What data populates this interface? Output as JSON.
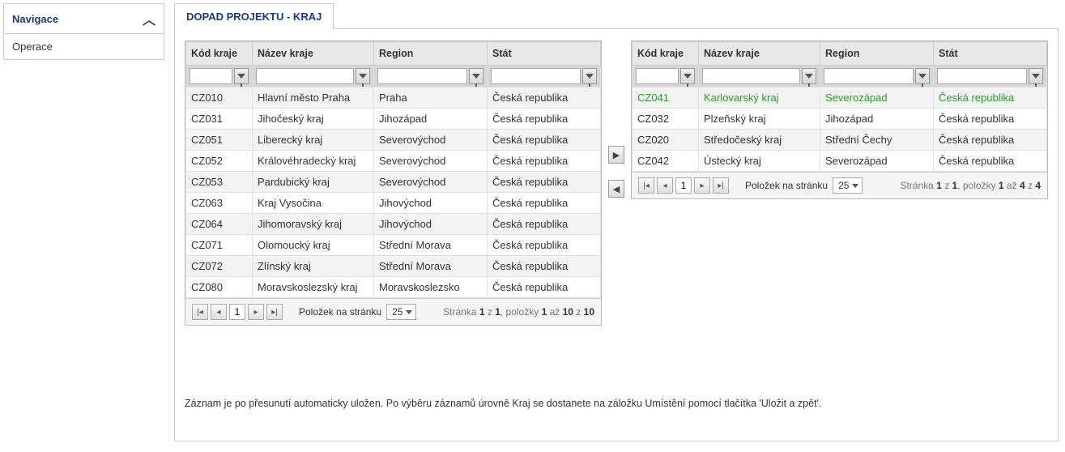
{
  "nav": {
    "header": "Navigace",
    "items": [
      "Operace"
    ]
  },
  "tab_title": "DOPAD PROJEKTU - KRAJ",
  "columns": {
    "code": "Kód kraje",
    "name": "Název kraje",
    "region": "Region",
    "state": "Stát"
  },
  "left_rows": [
    {
      "code": "CZ010",
      "name": "Hlavní město Praha",
      "region": "Praha",
      "state": "Česká republika"
    },
    {
      "code": "CZ031",
      "name": "Jihočeský kraj",
      "region": "Jihozápad",
      "state": "Česká republika"
    },
    {
      "code": "CZ051",
      "name": "Liberecký kraj",
      "region": "Severovýchod",
      "state": "Česká republika"
    },
    {
      "code": "CZ052",
      "name": "Královéhradecký kraj",
      "region": "Severovýchod",
      "state": "Česká republika"
    },
    {
      "code": "CZ053",
      "name": "Pardubický kraj",
      "region": "Severovýchod",
      "state": "Česká republika"
    },
    {
      "code": "CZ063",
      "name": "Kraj Vysočina",
      "region": "Jihovýchod",
      "state": "Česká republika"
    },
    {
      "code": "CZ064",
      "name": "Jihomoravský kraj",
      "region": "Jihovýchod",
      "state": "Česká republika"
    },
    {
      "code": "CZ071",
      "name": "Olomoucký kraj",
      "region": "Střední Morava",
      "state": "Česká republika"
    },
    {
      "code": "CZ072",
      "name": "Zlínský kraj",
      "region": "Střední Morava",
      "state": "Česká republika"
    },
    {
      "code": "CZ080",
      "name": "Moravskoslezský kraj",
      "region": "Moravskoslezsko",
      "state": "Česká republika"
    }
  ],
  "right_rows": [
    {
      "code": "CZ041",
      "name": "Karlovarský kraj",
      "region": "Severozápad",
      "state": "Česká republika",
      "hl": true
    },
    {
      "code": "CZ032",
      "name": "Plzeňský kraj",
      "region": "Jihozápad",
      "state": "Česká republika"
    },
    {
      "code": "CZ020",
      "name": "Středočeský kraj",
      "region": "Střední Čechy",
      "state": "Česká republika"
    },
    {
      "code": "CZ042",
      "name": "Ústecký kraj",
      "region": "Severozápad",
      "state": "Česká republika"
    }
  ],
  "pager": {
    "page": "1",
    "per_page_label": "Položek na stránku",
    "per_page_value": "25",
    "left_info_pre": "Stránka ",
    "left_info_b1": "1",
    "left_info_mid1": " z ",
    "left_info_b2": "1",
    "left_info_mid2": ", položky ",
    "left_info_b3": "1",
    "left_info_mid3": " až ",
    "left_info_b4": "10",
    "left_info_mid4": " z ",
    "left_info_b5": "10",
    "right_info_b4": "4",
    "right_info_b5": "4"
  },
  "hint": "Záznam je po přesunutí automaticky uložen. Po výběru záznamů úrovně Kraj se dostanete na záložku Umístění pomocí tlačítka 'Uložit a zpět'."
}
